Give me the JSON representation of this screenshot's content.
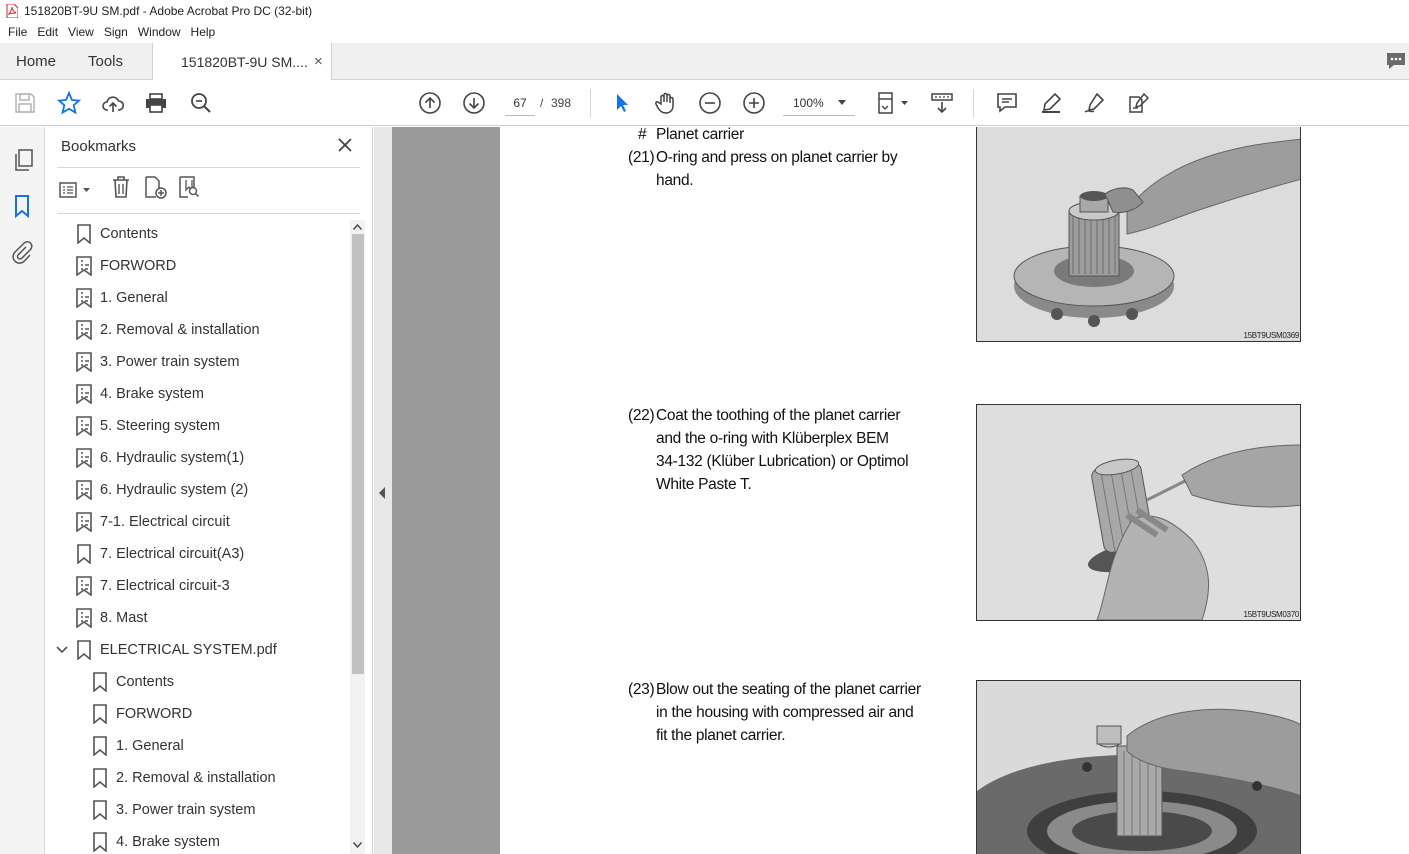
{
  "window": {
    "title": "151820BT-9U SM.pdf - Adobe Acrobat Pro DC (32-bit)"
  },
  "menu": [
    "File",
    "Edit",
    "View",
    "Sign",
    "Window",
    "Help"
  ],
  "tabs": {
    "home": "Home",
    "tools": "Tools",
    "doc": "151820BT-9U SM....",
    "close": "×"
  },
  "toolbar": {
    "page_current": "67",
    "page_sep": "/",
    "page_total": "398",
    "zoom": "100%"
  },
  "bookmarks": {
    "title": "Bookmarks",
    "items": [
      {
        "label": "Contents"
      },
      {
        "label": "FORWORD"
      },
      {
        "label": "1. General"
      },
      {
        "label": "2. Removal & installation"
      },
      {
        "label": "3. Power train system"
      },
      {
        "label": "4. Brake system"
      },
      {
        "label": "5. Steering system"
      },
      {
        "label": "6. Hydraulic system(1)"
      },
      {
        "label": "6. Hydraulic system (2)"
      },
      {
        "label": "7-1. Electrical circuit"
      },
      {
        "label": "7. Electrical circuit(A3)"
      },
      {
        "label": "7. Electrical circuit-3"
      },
      {
        "label": "8. Mast"
      },
      {
        "label": "ELECTRICAL SYSTEM.pdf"
      }
    ],
    "children": [
      {
        "label": "Contents"
      },
      {
        "label": "FORWORD"
      },
      {
        "label": "1. General"
      },
      {
        "label": "2. Removal & installation"
      },
      {
        "label": "3. Power train system"
      },
      {
        "label": "4. Brake system"
      }
    ]
  },
  "document": {
    "step_hash": {
      "num": "#",
      "text": "Planet carrier"
    },
    "step21": {
      "num": "(21)",
      "lines": [
        "O-ring and press on planet carrier by",
        "hand."
      ]
    },
    "step22": {
      "num": "(22)",
      "lines": [
        "Coat the toothing of the planet carrier",
        "and the o-ring with Klüberplex BEM",
        "34-132 (Klüber Lubrication) or Optimol",
        "White Paste T."
      ]
    },
    "step23": {
      "num": "(23)",
      "lines": [
        "Blow out the seating of the planet carrier",
        "in the housing with compressed air and",
        "fit the planet carrier."
      ]
    },
    "captions": [
      "15BT9USM0369",
      "15BT9USM0370"
    ]
  }
}
